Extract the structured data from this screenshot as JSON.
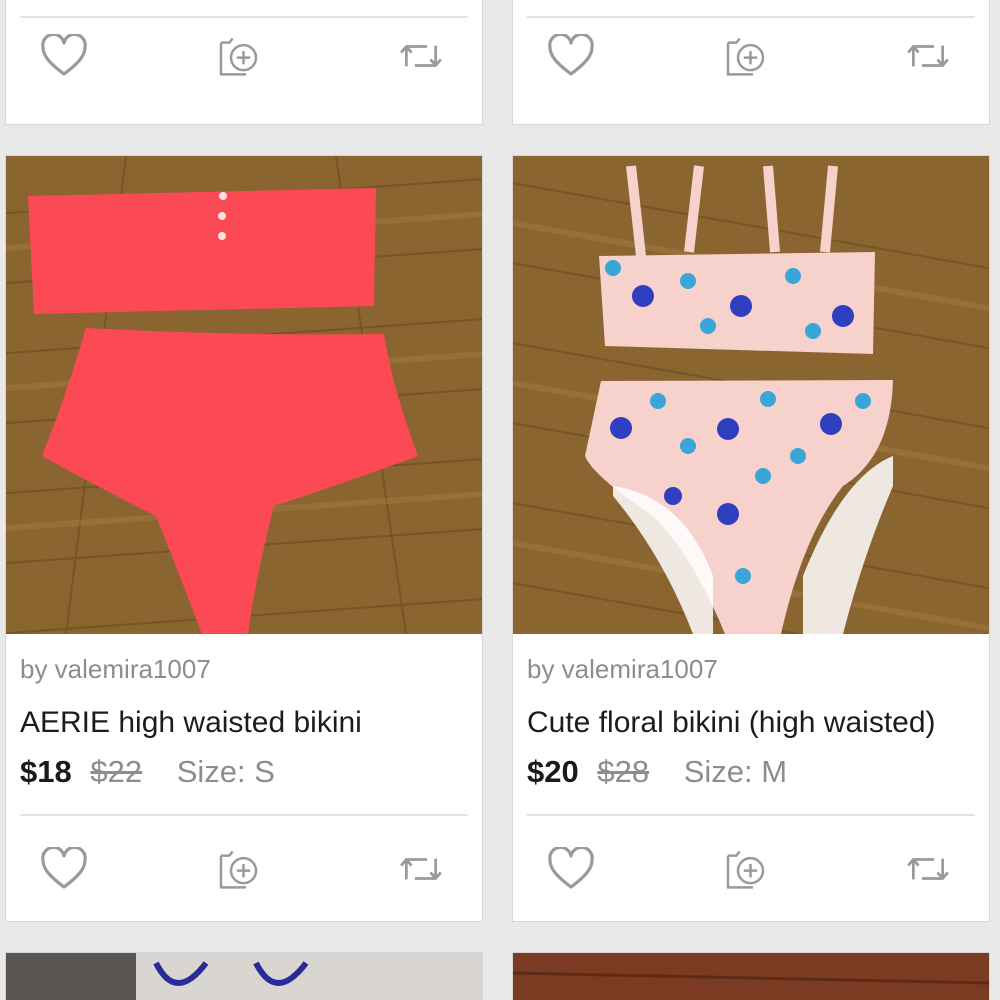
{
  "listings": [
    {
      "seller": "by valemira1007",
      "title": "AERIE high waisted bikini",
      "price": "$18",
      "original_price": "$22",
      "size": "Size: S",
      "colors": {
        "fabric": "#fb4a55"
      }
    },
    {
      "seller": "by valemira1007",
      "title": "Cute floral bikini (high waisted)",
      "price": "$20",
      "original_price": "$28",
      "size": "Size: M",
      "colors": {
        "fabric": "#f7d2cc",
        "flower_dark": "#2f3fbf",
        "flower_light": "#3aa6d8"
      }
    }
  ],
  "icons": {
    "like": "heart-icon",
    "bundle": "add-to-bundle-icon",
    "share": "share-repost-icon"
  },
  "colors": {
    "icon": "#9a9a9a",
    "wood": "#8a6530",
    "background": "#e9e9e9"
  }
}
